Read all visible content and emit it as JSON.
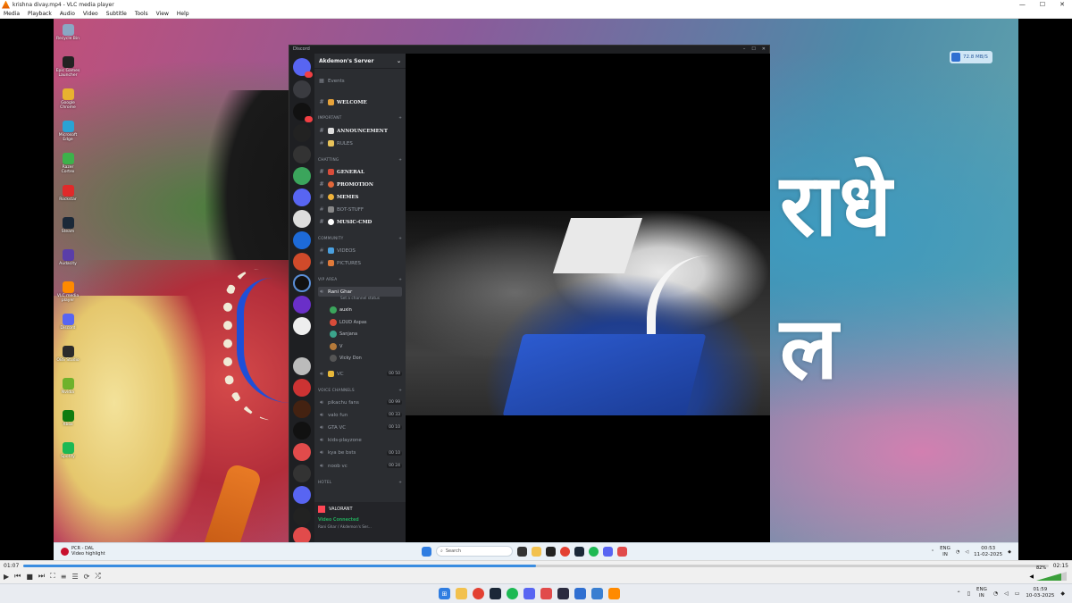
{
  "vlc": {
    "title": "krishna divay.mp4 - VLC media player",
    "menu": [
      "Media",
      "Playback",
      "Audio",
      "Video",
      "Subtitle",
      "Tools",
      "View",
      "Help"
    ],
    "elapsed": "01:07",
    "duration": "02:15",
    "progress": 0.5,
    "volume_label": "82%",
    "volume_level": 0.82
  },
  "inner_desktop": {
    "hindi_line1": "राधे",
    "hindi_line2": "ल",
    "speed_widget": "72.8 MB/S",
    "icons": [
      {
        "label": "Recycle Bin",
        "color": "#8aa7c4"
      },
      {
        "label": "Epic Games Launcher",
        "color": "#222"
      },
      {
        "label": "Google Chrome",
        "color": "#e8b230"
      },
      {
        "label": "Microsoft Edge",
        "color": "#2aa3d4"
      },
      {
        "label": "Razer Cortex",
        "color": "#3db24b"
      },
      {
        "label": "Rockstar",
        "color": "#e02a2a"
      },
      {
        "label": "Steam",
        "color": "#1b2838"
      },
      {
        "label": "Audacity",
        "color": "#5a3ea8"
      },
      {
        "label": "VLC media player",
        "color": "#ff8a00"
      },
      {
        "label": "Discord",
        "color": "#5865f2"
      },
      {
        "label": "OBS Studio",
        "color": "#2b2b2b"
      },
      {
        "label": "Nvidia",
        "color": "#6fb22b"
      },
      {
        "label": "Xbox",
        "color": "#107c10"
      },
      {
        "label": "Spotify",
        "color": "#1db954"
      }
    ],
    "taskbar": {
      "news_title": "PCR - DAL",
      "news_sub": "Video highlight",
      "search_placeholder": "Search",
      "lang": "ENG",
      "lang_sub": "IN",
      "time": "00:53",
      "date": "11-02-2025"
    }
  },
  "discord": {
    "app_name": "Discord",
    "server_name": "Akdemon's Server",
    "events_label": "Events",
    "welcome": "WELCOME",
    "categories": {
      "important": "IMPORTANT",
      "chatting": "CHATTING",
      "community": "COMMUNITY",
      "vip": "VIP AREA",
      "voice": "VOICE CHANNELS",
      "hotel": "HOTEL"
    },
    "important_channels": [
      "ANNOUNCEMENT",
      "RULES"
    ],
    "chatting_channels": [
      "GENERAL",
      "PROMOTION",
      "MEMES",
      "BOT-STUFF",
      "MUSIC-CMD"
    ],
    "community_channels": [
      "VIDEOS",
      "PICTURES"
    ],
    "vip_voice": {
      "name": "Rani Ghar",
      "status": "Set a channel status",
      "users": [
        "auxin",
        "LOUD Aspas",
        "Sanjana",
        "V",
        "Vicky Don"
      ]
    },
    "vc_lock": {
      "name": "VC",
      "count_a": "00",
      "count_b": "50"
    },
    "voice_channels": [
      {
        "name": "pikachu fans",
        "a": "00",
        "b": "99"
      },
      {
        "name": "valo fun",
        "a": "00",
        "b": "33"
      },
      {
        "name": "GTA VC",
        "a": "00",
        "b": "10"
      },
      {
        "name": "kids-playzone",
        "a": "",
        "b": ""
      },
      {
        "name": "kya be bsts",
        "a": "00",
        "b": "10"
      },
      {
        "name": "noob vc",
        "a": "00",
        "b": "24"
      }
    ],
    "bottom": {
      "game": "VALORANT",
      "vc_status": "Video Connected",
      "vc_sub": "Rani Ghar / Akdemon's Ser..."
    }
  },
  "host_taskbar": {
    "lang": "ENG",
    "lang_sub": "IN",
    "time": "01:59",
    "date": "10-03-2025"
  }
}
